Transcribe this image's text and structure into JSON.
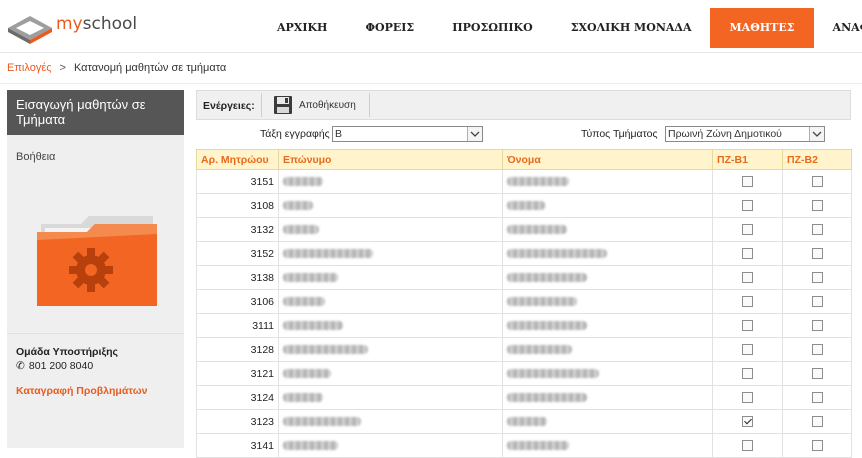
{
  "brand": {
    "prefix": "my",
    "suffix": "school"
  },
  "nav": {
    "items": [
      "ΑΡΧΙΚΗ",
      "ΦΟΡΕΙΣ",
      "ΠΡΟΣΩΠΙΚΟ",
      "ΣΧΟΛΙΚΗ ΜΟΝΑΔΑ",
      "ΜΑΘΗΤΕΣ",
      "ΑΝΑΦΟΡΕΣ"
    ],
    "active": "ΜΑΘΗΤΕΣ"
  },
  "breadcrumb": {
    "root": "Επιλογές",
    "separator": ">",
    "current": "Κατανομή μαθητών σε τμήματα"
  },
  "sidebar": {
    "title": "Εισαγωγή μαθητών σε Τμήματα",
    "help": "Βοήθεια",
    "support_title": "Ομάδα Υποστήριξης",
    "support_phone": "801 200 8040",
    "report_link": "Καταγραφή Προβλημάτων"
  },
  "toolbar": {
    "actions_label": "Ενέργειες:",
    "save_label": "Αποθήκευση"
  },
  "filters": {
    "grade_label": "Τάξη εγγραφής",
    "grade_value": "Β",
    "section_type_label": "Τύπος Τμήματος",
    "section_type_value": "Πρωινή Ζώνη Δημοτικού"
  },
  "table": {
    "headers": [
      "Αρ. Μητρώου",
      "Επώνυμο",
      "Όνομα",
      "ΠΖ-Β1",
      "ΠΖ-Β2"
    ],
    "rows": [
      {
        "id": "3151",
        "pz_b1": false,
        "pz_b2": false
      },
      {
        "id": "3108",
        "pz_b1": false,
        "pz_b2": false
      },
      {
        "id": "3132",
        "pz_b1": false,
        "pz_b2": false
      },
      {
        "id": "3152",
        "pz_b1": false,
        "pz_b2": false
      },
      {
        "id": "3138",
        "pz_b1": false,
        "pz_b2": false
      },
      {
        "id": "3106",
        "pz_b1": false,
        "pz_b2": false
      },
      {
        "id": "3111",
        "pz_b1": false,
        "pz_b2": false
      },
      {
        "id": "3128",
        "pz_b1": false,
        "pz_b2": false
      },
      {
        "id": "3121",
        "pz_b1": false,
        "pz_b2": false
      },
      {
        "id": "3124",
        "pz_b1": false,
        "pz_b2": false
      },
      {
        "id": "3123",
        "pz_b1": true,
        "pz_b2": false
      },
      {
        "id": "3141",
        "pz_b1": false,
        "pz_b2": false
      }
    ]
  },
  "colors": {
    "accent": "#f26522",
    "header_bg": "#fff4cc",
    "sidebar_title_bg": "#565656"
  }
}
